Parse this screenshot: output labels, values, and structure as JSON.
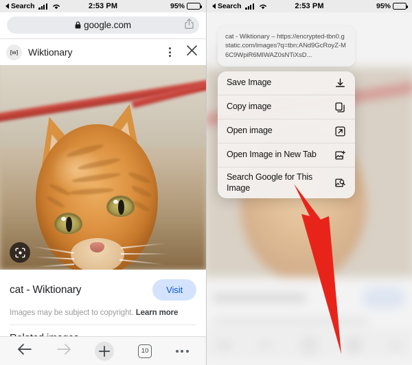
{
  "status_bar": {
    "back_label": "Search",
    "time": "2:53 PM",
    "battery_percent": "95%"
  },
  "left_panel": {
    "address_bar": {
      "url": "google.com",
      "lock_icon": "lock-icon",
      "share_icon": "share-icon"
    },
    "site_header": {
      "favicon_text": "[w]",
      "title": "Wiktionary",
      "menu_icon": "kebab-menu-icon",
      "close_icon": "close-icon"
    },
    "image_viewer": {
      "lens_icon": "google-lens-icon",
      "alt": "orange tabby cat"
    },
    "caption": {
      "title": "cat - Wiktionary",
      "visit_label": "Visit",
      "copyright_text": "Images may be subject to copyright.",
      "learn_more_label": "Learn more"
    },
    "related_section_label": "Related images",
    "toolbar": {
      "back_icon": "arrow-left-icon",
      "forward_icon": "arrow-right-icon",
      "new_tab_icon": "plus-icon",
      "tab_count": "10",
      "more_icon": "ellipsis-icon"
    }
  },
  "right_panel": {
    "link_preview": "cat - Wiktionary – https://encrypted-tbn0.gstatic.com/images?q=tbn:ANd9GcRoyZ-M6C9WpiR6MIWAZ0sNTiXsD...",
    "context_menu": [
      {
        "label": "Save Image",
        "icon": "download-icon"
      },
      {
        "label": "Copy image",
        "icon": "copy-icon"
      },
      {
        "label": "Open image",
        "icon": "external-link-icon"
      },
      {
        "label": "Open Image in New Tab",
        "icon": "image-add-icon"
      },
      {
        "label": "Search Google for This Image",
        "icon": "image-search-icon"
      }
    ],
    "annotation": {
      "type": "arrow",
      "color": "#e8241a",
      "points_to": "Search Google for This Image"
    }
  },
  "colors": {
    "accent_blue": "#0b57d0",
    "visit_chip_bg": "#d3e3fd",
    "status_bar_bg": "#ebebeb",
    "address_bar_bg": "#e8eaed",
    "annotation_red": "#e8241a",
    "menu_bg": "#f3f0ed"
  }
}
